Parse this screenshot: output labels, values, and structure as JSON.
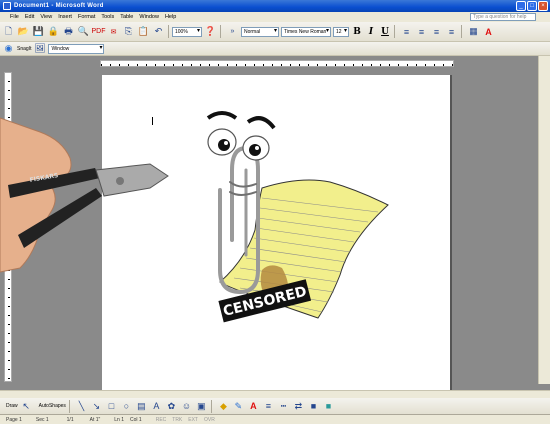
{
  "window": {
    "title": "Document1 - Microsoft Word"
  },
  "menu": [
    "File",
    "Edit",
    "View",
    "Insert",
    "Format",
    "Tools",
    "Table",
    "Window",
    "Help"
  ],
  "ask_placeholder": "Type a question for help",
  "toolbar": {
    "zoom": "100%",
    "style": "Normal",
    "font": "Times New Roman",
    "size": "12",
    "bold": "B",
    "italic": "I",
    "underline": "U"
  },
  "snagit": {
    "label": "SnagIt",
    "window_combo": "Window"
  },
  "drawing": {
    "draw_label": "Draw",
    "autoshapes_label": "AutoShapes"
  },
  "status": {
    "page": "Page 1",
    "sec": "Sec 1",
    "pages": "1/1",
    "at": "At 1\"",
    "ln": "Ln 1",
    "col": "Col 1",
    "rec": "REC",
    "trk": "TRK",
    "ext": "EXT",
    "ovr": "OVR"
  },
  "sign_text": "CENSORED",
  "tool_brand": "FISKARS",
  "colors": {
    "title_bar": "#0a4fd0",
    "paper": "#f2ef8c",
    "font_color_swatch": "#e01010"
  }
}
